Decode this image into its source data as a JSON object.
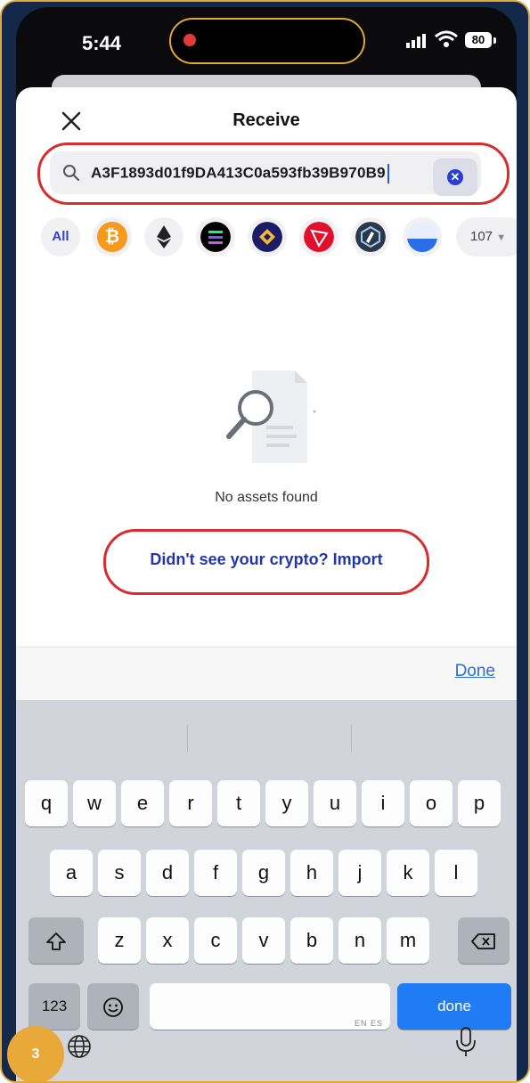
{
  "status_bar": {
    "time": "5:44",
    "battery": "80"
  },
  "header": {
    "title": "Receive"
  },
  "search": {
    "value": "A3F1893d01f9DA413C0a593fb39B970B9"
  },
  "chips": {
    "all_label": "All",
    "count_label": "107"
  },
  "empty_state": {
    "message": "No assets found",
    "import_link": "Didn't see your crypto? Import"
  },
  "keyboard": {
    "accessory_done": "Done",
    "row1": [
      "q",
      "w",
      "e",
      "r",
      "t",
      "y",
      "u",
      "i",
      "o",
      "p"
    ],
    "row2": [
      "a",
      "s",
      "d",
      "f",
      "g",
      "h",
      "j",
      "k",
      "l"
    ],
    "row3": [
      "z",
      "x",
      "c",
      "v",
      "b",
      "n",
      "m"
    ],
    "numbers_label": "123",
    "space_sub": "EN ES",
    "done_label": "done"
  },
  "step_badge": "3",
  "colors": {
    "accent": "#2336a8",
    "highlight": "#d92c2c",
    "frame": "#14284a",
    "badge": "#e8a83a"
  }
}
